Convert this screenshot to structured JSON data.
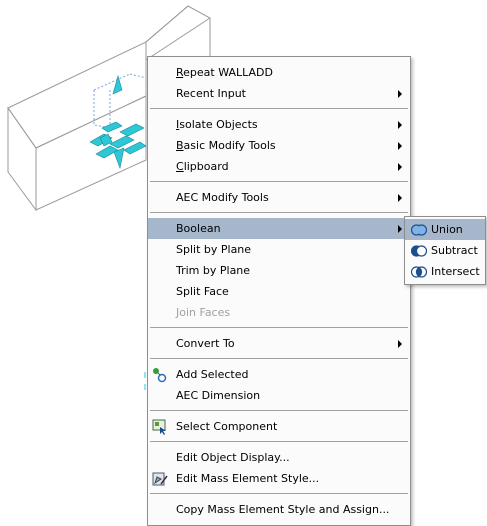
{
  "menu": {
    "items": [
      {
        "label": "Repeat WALLADD",
        "accel": "R",
        "rest": "epeat WALLADD",
        "submenu": false
      },
      {
        "label": "Recent Input",
        "submenu": true
      },
      {
        "label": "Isolate Objects",
        "accel": "I",
        "rest": "solate Objects",
        "submenu": true
      },
      {
        "label": "Basic Modify Tools",
        "accel": "B",
        "rest": "asic Modify Tools",
        "submenu": true
      },
      {
        "label": "Clipboard",
        "accel": "C",
        "rest": "lipboard",
        "submenu": true
      },
      {
        "label": "AEC Modify Tools",
        "submenu": true
      },
      {
        "label": "Boolean",
        "submenu": true,
        "highlighted": true
      },
      {
        "label": "Split by Plane"
      },
      {
        "label": "Trim by Plane"
      },
      {
        "label": "Split Face"
      },
      {
        "label": "Join Faces",
        "disabled": true
      },
      {
        "label": "Convert To",
        "submenu": true
      },
      {
        "label": "Add Selected",
        "icon": "add-selected-icon"
      },
      {
        "label": "AEC Dimension"
      },
      {
        "label": "Select Component",
        "icon": "select-component-icon"
      },
      {
        "label": "Edit Object Display..."
      },
      {
        "label": "Edit Mass Element Style...",
        "icon": "edit-style-icon"
      },
      {
        "label": "Copy Mass Element Style and Assign..."
      }
    ]
  },
  "submenu": {
    "items": [
      {
        "label": "Union",
        "icon": "union-icon",
        "highlighted": true
      },
      {
        "label": "Subtract",
        "icon": "subtract-icon"
      },
      {
        "label": "Intersect",
        "icon": "intersect-icon"
      }
    ]
  },
  "colors": {
    "highlight": "#a6b7cc",
    "grip_cyan": "#2ec7d6",
    "wireframe": "#9a9a9a",
    "selection_dashed": "#7aa6d8"
  }
}
